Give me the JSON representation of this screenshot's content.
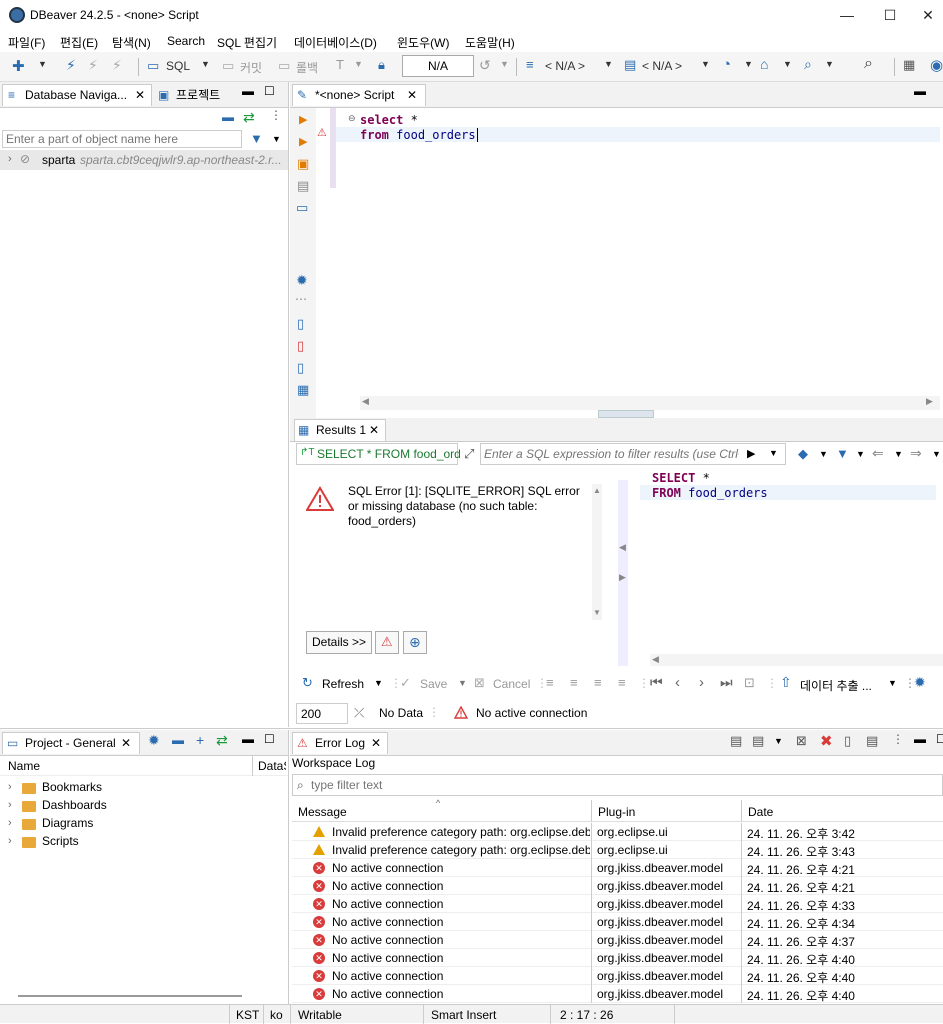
{
  "title": {
    "app": "DBeaver 24.2.5 - <none> Script",
    "min": "—",
    "max": "☐",
    "close": "✕"
  },
  "menu": [
    "파일(F)",
    "편집(E)",
    "탐색(N)",
    "Search",
    "SQL 편집기",
    "데이터베이스(D)",
    "윈도우(W)",
    "도움말(H)"
  ],
  "toolbar": {
    "sql": "SQL",
    "commit": "커밋",
    "rollback": "롤백",
    "tx_mode": "N/A",
    "datasource": "< N/A >",
    "schema": "< N/A >"
  },
  "navigator": {
    "tab_label": "Database Naviga...",
    "projects_tab": "프로젝트",
    "filter_placeholder": "Enter a part of object name here",
    "connection_name": "sparta",
    "connection_host": "sparta.cbt9ceqjwlr9.ap-northeast-2.r..."
  },
  "editor": {
    "tab_label": "*<none> Script",
    "line1_kw": "select",
    "line1_rest": " *",
    "line2_kw": "from",
    "line2_table": "food_orders"
  },
  "results": {
    "tab_label": "Results 1",
    "query_label": "SELECT * FROM food_ord",
    "filter_placeholder": "Enter a SQL expression to filter results (use Ctrl+",
    "error_message": "SQL Error [1]: [SQLITE_ERROR] SQL error or missing database (no such table: food_orders)",
    "details_button": "Details >>",
    "query_line1_kw": "SELECT",
    "query_line1_rest": " *",
    "query_line2_kw": "FROM",
    "query_line2_table": "food_orders",
    "refresh": "Refresh",
    "save": "Save",
    "cancel": "Cancel",
    "export": "데이터 추출 ...",
    "fetch_size": "200",
    "no_data": "No Data",
    "no_connection": "No active connection"
  },
  "project": {
    "tab_label": "Project - General",
    "col_name": "Name",
    "col_ds": "DataS",
    "items": [
      "Bookmarks",
      "Dashboards",
      "Diagrams",
      "Scripts"
    ]
  },
  "errorlog": {
    "tab_label": "Error Log",
    "workspace": "Workspace Log",
    "filter_placeholder": "type filter text",
    "col_message": "Message",
    "col_plugin": "Plug-in",
    "col_date": "Date",
    "rows": [
      {
        "type": "warn",
        "message": "Invalid preference category path: org.eclipse.deb",
        "plugin": "org.eclipse.ui",
        "date": "24. 11. 26. 오후 3:42"
      },
      {
        "type": "warn",
        "message": "Invalid preference category path: org.eclipse.deb",
        "plugin": "org.eclipse.ui",
        "date": "24. 11. 26. 오후 3:43"
      },
      {
        "type": "error",
        "message": "No active connection",
        "plugin": "org.jkiss.dbeaver.model",
        "date": "24. 11. 26. 오후 4:21"
      },
      {
        "type": "error",
        "message": "No active connection",
        "plugin": "org.jkiss.dbeaver.model",
        "date": "24. 11. 26. 오후 4:21"
      },
      {
        "type": "error",
        "message": "No active connection",
        "plugin": "org.jkiss.dbeaver.model",
        "date": "24. 11. 26. 오후 4:33"
      },
      {
        "type": "error",
        "message": "No active connection",
        "plugin": "org.jkiss.dbeaver.model",
        "date": "24. 11. 26. 오후 4:34"
      },
      {
        "type": "error",
        "message": "No active connection",
        "plugin": "org.jkiss.dbeaver.model",
        "date": "24. 11. 26. 오후 4:37"
      },
      {
        "type": "error",
        "message": "No active connection",
        "plugin": "org.jkiss.dbeaver.model",
        "date": "24. 11. 26. 오후 4:40"
      },
      {
        "type": "error",
        "message": "No active connection",
        "plugin": "org.jkiss.dbeaver.model",
        "date": "24. 11. 26. 오후 4:40"
      },
      {
        "type": "error",
        "message": "No active connection",
        "plugin": "org.jkiss.dbeaver.model",
        "date": "24. 11. 26. 오후 4:40"
      }
    ]
  },
  "status": {
    "tz": "KST",
    "locale": "ko",
    "mode": "Writable",
    "insert": "Smart Insert",
    "position": "2 : 17 : 26"
  }
}
